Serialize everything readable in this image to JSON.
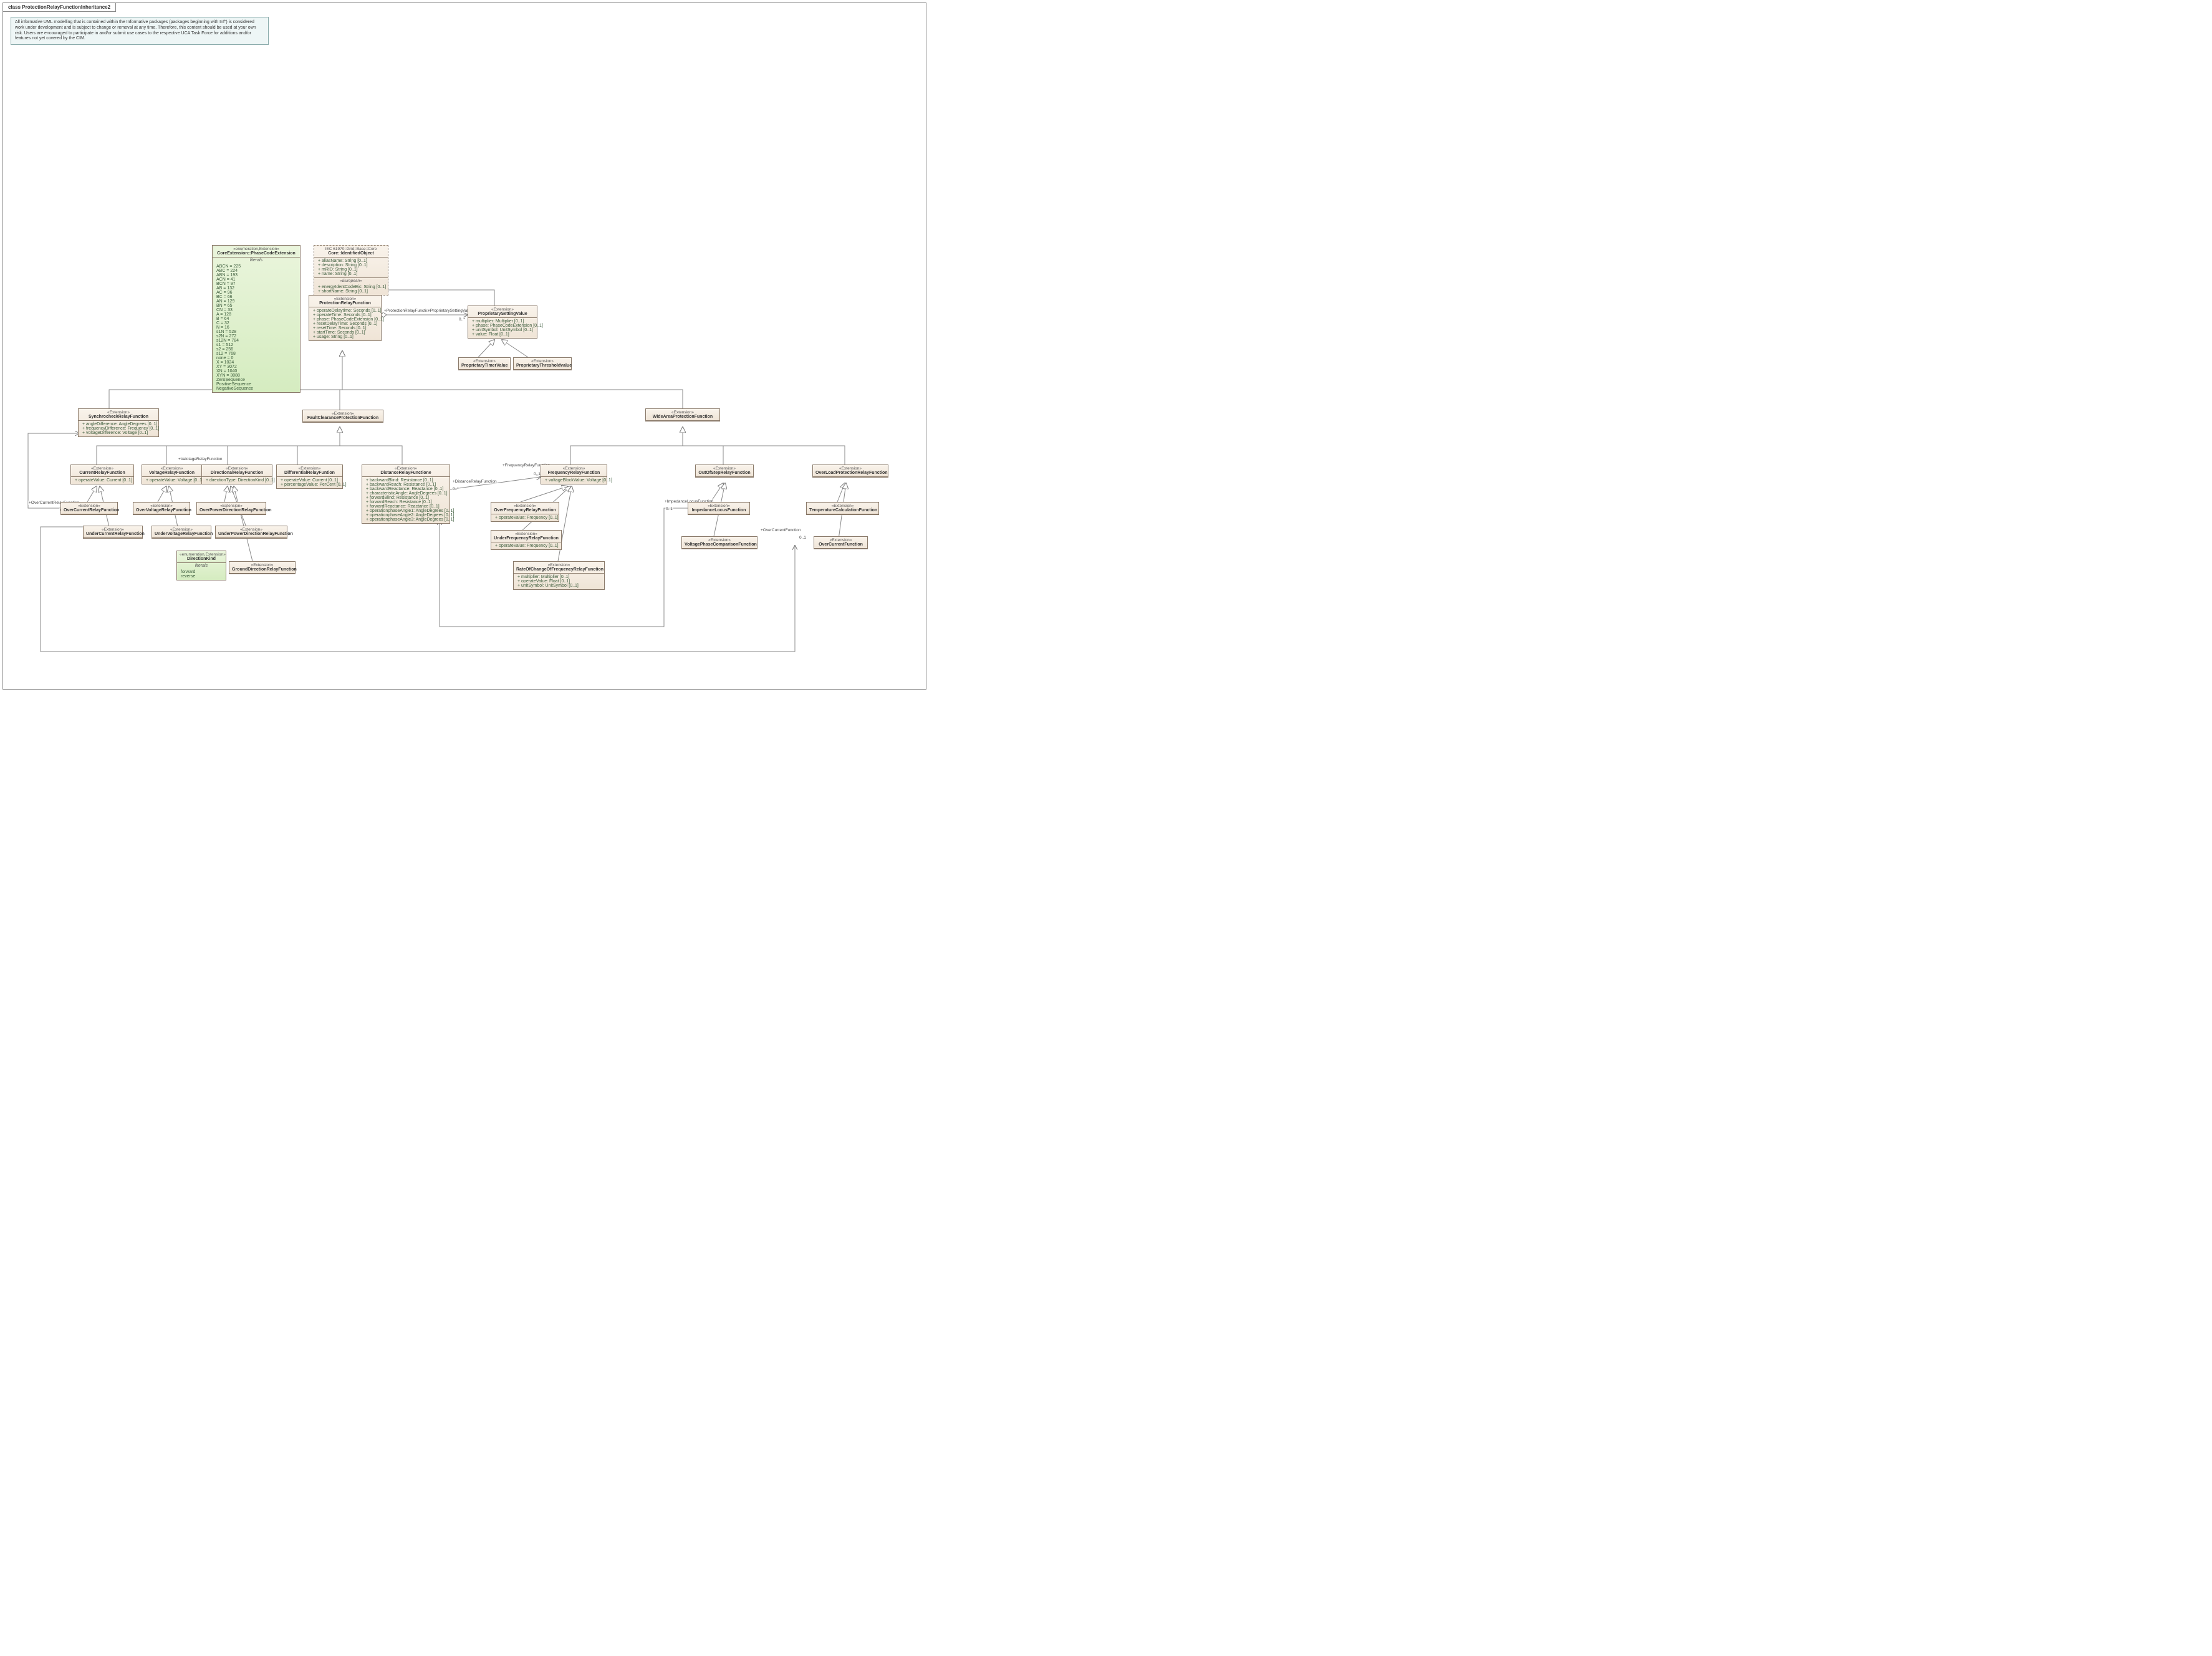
{
  "diagram": {
    "title": "class ProtectionRelayFunctionInheritance2"
  },
  "note": "All informative UML modelling that is contained within the Informative packages (packages beginning with Inf\") is considered work under development and is subject to change or removal at any time. Therefore, this content should be used at your own risk. Users are encouraged to participate in and/or submit use cases to the respective UCA Task Force for additions and/or features not yet covered by the CIM.",
  "phaseCodeExt": {
    "stereo": "«enumeration,Extension»",
    "name": "CoreExtension::PhaseCodeExtension",
    "litLabel": "literals",
    "literals": [
      "ABCN = 225",
      "ABC = 224",
      "ABN = 193",
      "ACN = 41",
      "BCN = 97",
      "AB = 132",
      "AC = 96",
      "BC = 66",
      "AN = 129",
      "BN = 65",
      "CN = 33",
      "A = 128",
      "B = 64",
      "C = 32",
      "N = 16",
      "s1N = 528",
      "s2N = 272",
      "s12N = 784",
      "s1 = 512",
      "s2 = 256",
      "s12 = 768",
      "none = 0",
      "X = 1024",
      "XY = 3072",
      "XN = 1040",
      "XYN = 3088",
      "ZeroSequence",
      "PositiveSequence",
      "NegativeSequence"
    ]
  },
  "identifiedObject": {
    "pkg": "IEC 61970::Grid::Base::Core",
    "name": "Core::IdentifiedObject",
    "attrs": [
      "aliasName: String [0..1]",
      "description: String [0..1]",
      "mRID: String [0..1]",
      "name: String [0..1]"
    ],
    "stereo2": "«European»",
    "attrs2": [
      "energyIdentCodeEic: String [0..1]",
      "shortName: String [0..1]"
    ]
  },
  "prf": {
    "stereo": "«Extension»",
    "name": "ProtectionRelayFunction",
    "attrs": [
      "operateDelaytime: Seconds [0..1]",
      "operateTime: Seconds [0..1]",
      "phase: PhaseCodeExtension [0..1]",
      "resetDelayTime: Seconds [0..1]",
      "resetTime: Seconds [0..1]",
      "startTime: Seconds [0..1]",
      "usage: String [0..1]"
    ]
  },
  "psv": {
    "stereo": "«Extension»",
    "name": "ProprietarySettingValue",
    "attrs": [
      "multiplier: Multiplier [0..1]",
      "phase: PhaseCodeExtension [0..1]",
      "unitSymbol: UnitSymbol [0..1]",
      "value: Float [0..1]"
    ]
  },
  "ptv": {
    "stereo": "«Extension»",
    "name": "ProprietaryTimerValue"
  },
  "pthv": {
    "stereo": "«Extension»",
    "name": "ProprietaryThresholdvalue"
  },
  "sync": {
    "stereo": "«Extension»",
    "name": "SynchrocheckRelayFunction",
    "attrs": [
      "angleDifference: AngleDegrees [0..1]",
      "frequencyDifference: Frequency [0..1]",
      "voltageDifference: Voltage [0..1]"
    ]
  },
  "fcpf": {
    "stereo": "«Extension»",
    "name": "FaultClearanceProtectionFunction"
  },
  "wapf": {
    "stereo": "«Extension»",
    "name": "WideAreaProtectionFunction"
  },
  "crf": {
    "stereo": "«Extension»",
    "name": "CurrentRelayFunction",
    "attrs": [
      "operateValue: Current [0..1]"
    ]
  },
  "vrf": {
    "stereo": "«Extension»",
    "name": "VoltageRelayFunction",
    "attrs": [
      "operateValue: Voltage [0..1]"
    ]
  },
  "drf": {
    "stereo": "«Extension»",
    "name": "DirectionalRelayFunction",
    "attrs": [
      "directionType: DirectionKind [0..1]"
    ]
  },
  "diff": {
    "stereo": "«Extension»",
    "name": "DifferentialRelayFuntion",
    "attrs": [
      "operateValue: Current [0..1]",
      "percentageValue: PerCent [0..1]"
    ]
  },
  "dist": {
    "stereo": "«Extension»",
    "name": "DistanceRelayFunctione",
    "attrs": [
      "backwardBlind: Resistance [0..1]",
      "backwardReach: Resistance [0..1]",
      "backwardReactance: Reactance [0..1]",
      "characteristicAngle: AngleDegrees [0..1]",
      "forwardBlind: Resistance [0..1]",
      "forwardReach: Resistance [0..1]",
      "forwardReactance: Reactance [0..1]",
      "operationphaseAngle1: AngleDegrees [0..1]",
      "operationphaseAngle2: AngleDegrees [0..1]",
      "operationphaseAngle3: AngleDegrees [0..1]"
    ]
  },
  "ocrf": {
    "stereo": "«Extension»",
    "name": "OverCurrentRelayFunction"
  },
  "ucrf": {
    "stereo": "«Extension»",
    "name": "UnderCurrentRelayFunction"
  },
  "ovrf": {
    "stereo": "«Extension»",
    "name": "OverVoltageRelayFunction"
  },
  "uvrf": {
    "stereo": "«Extension»",
    "name": "UnderVoltageRelayFunction"
  },
  "opdrf": {
    "stereo": "«Extension»",
    "name": "OverPowerDirectionRelayFunction"
  },
  "updrf": {
    "stereo": "«Extension»",
    "name": "UnderPowerDirectionRelayFunction"
  },
  "gdrf": {
    "stereo": "«Extension»",
    "name": "GroundDirectionRelayFunction"
  },
  "dirKind": {
    "stereo": "«enumeration,Extension»",
    "name": "DirectionKind",
    "litLabel": "literals",
    "literals": [
      "forward",
      "reverse"
    ]
  },
  "frf": {
    "stereo": "«Extension»",
    "name": "FrequencyRelayFunction",
    "attrs": [
      "voltageBlockValue: Voltage [0..1]"
    ]
  },
  "osrf": {
    "stereo": "«Extension»",
    "name": "OutOfStepRelayFunction"
  },
  "olprf": {
    "stereo": "«Extension»",
    "name": "OverLoadProtectionRelayFunction"
  },
  "ofrf": {
    "stereo": "«Extension»",
    "name": "OverFrequencyRelayFunction",
    "attrs": [
      "operateValue: Frequency [0..1]"
    ]
  },
  "ufrf": {
    "stereo": "«Extension»",
    "name": "UnderFrequencyRelayFunction",
    "attrs": [
      "operateValue: Frequency [0..1]"
    ]
  },
  "rocof": {
    "stereo": "«Extension»",
    "name": "RateOfChangeOfFrequencyRelayFunction",
    "attrs": [
      "multiplier: Multiplier [0..1]",
      "operateValue: Float [0..1]",
      "unitSymbol: UnitSymbol [0..1]"
    ]
  },
  "ilf": {
    "stereo": "«Extension»",
    "name": "ImpedanceLocusFunction"
  },
  "vpcf": {
    "stereo": "«Extension»",
    "name": "VoltagePhaseComparisonFunction"
  },
  "tcf": {
    "stereo": "«Extension»",
    "name": "TemperatureCalculationFunction"
  },
  "ocf": {
    "stereo": "«Extension»",
    "name": "OverCurrentFunction"
  },
  "assoc": {
    "prfRole": "+ProtectionRelayFunction",
    "psvRole": "+ProprietarySettingValue",
    "psvMult": "0..*",
    "vrfRole": "+ValotageRelayFunction",
    "vrfMult": "0..*",
    "frfRole": "+FrequencyRelayFunction",
    "frfMult": "0..1",
    "drfRole": "+DistanceRelayFunction",
    "drfMult": "0..*",
    "ilfRole": "+ImpedanceLocusFunction",
    "ilfMult": "0..1",
    "ocrfRole": "+OverCurrentRelayFunction",
    "ocrfMult": "0..*",
    "ocfRole": "+OverCurrentFunction",
    "ocfMult": "0..1"
  }
}
